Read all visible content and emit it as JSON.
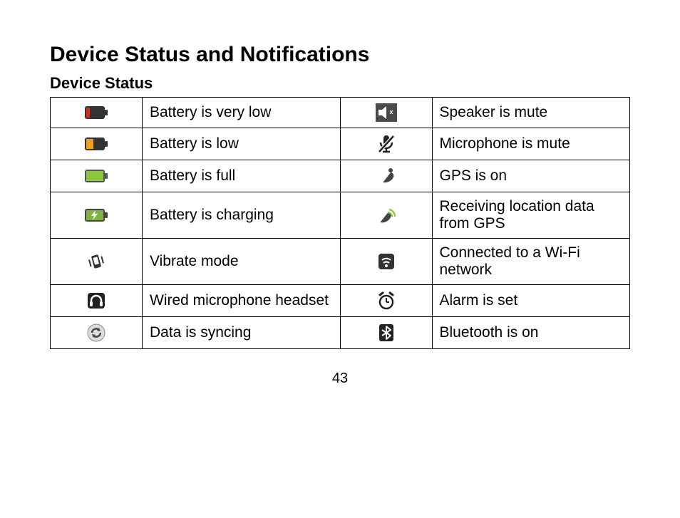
{
  "heading": "Device Status and Notifications",
  "subheading": "Device Status",
  "page_number": "43",
  "rows": [
    {
      "left": "Battery is very low",
      "right": "Speaker is mute"
    },
    {
      "left": "Battery is low",
      "right": "Microphone is mute"
    },
    {
      "left": "Battery is full",
      "right": "GPS is on"
    },
    {
      "left": "Battery is charging",
      "right": "Receiving location data from GPS"
    },
    {
      "left": "Vibrate mode",
      "right": "Connected to a Wi-Fi network"
    },
    {
      "left": "Wired microphone headset",
      "right": "Alarm is set"
    },
    {
      "left": "Data is syncing",
      "right": "Bluetooth is on"
    }
  ]
}
